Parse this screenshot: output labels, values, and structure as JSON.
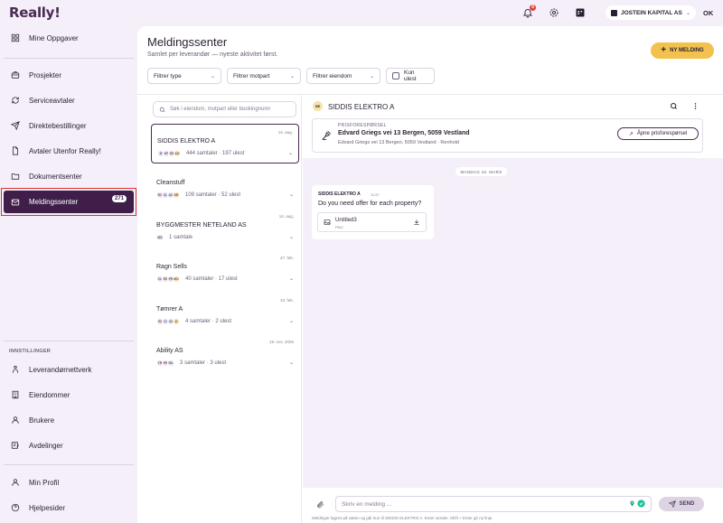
{
  "app": {
    "logo": "Really!"
  },
  "topbar": {
    "notification_count": "9",
    "org_name": "JOSTEIN KAPITAL AS",
    "user_initials": "OK"
  },
  "sidebar": {
    "items": [
      {
        "label": "Mine Oppgaver",
        "icon": "grid-icon"
      },
      {
        "label": "Prosjekter",
        "icon": "briefcase-icon"
      },
      {
        "label": "Serviceavtaler",
        "icon": "refresh-icon"
      },
      {
        "label": "Direktebestillinger",
        "icon": "send-icon"
      },
      {
        "label": "Avtaler Utenfor Really!",
        "icon": "document-icon"
      },
      {
        "label": "Dokumentsenter",
        "icon": "folder-icon"
      },
      {
        "label": "Meldingssenter",
        "icon": "mail-icon",
        "badge": "271",
        "active": true
      }
    ],
    "settings_label": "INNSTILLINGER",
    "settings_items": [
      {
        "label": "Leverandørnettverk",
        "icon": "network-icon"
      },
      {
        "label": "Eiendommer",
        "icon": "building-icon"
      },
      {
        "label": "Brukere",
        "icon": "user-icon"
      },
      {
        "label": "Avdelinger",
        "icon": "department-icon"
      }
    ],
    "footer_items": [
      {
        "label": "Min Profil",
        "icon": "profile-icon"
      },
      {
        "label": "Hjelpesider",
        "icon": "help-icon"
      }
    ]
  },
  "main": {
    "title": "Meldingssenter",
    "subtitle": "Samlet per leverandør — nyeste aktivitet først.",
    "new_button": "NY MELDING",
    "filters": {
      "type": "Filtrer type",
      "counterparty": "Filtrer motpart",
      "property": "Filtrer eiendom",
      "unread": "Kun ulest"
    },
    "search_placeholder": "Søk i eiendom, motpart eller bookingnumr"
  },
  "conversations": [
    {
      "name": "SIDDIS ELEKTRO A",
      "date": "14. aug.",
      "meta": "444 samtaler · 197 ulest",
      "avatars": [
        "H",
        "KF",
        "SE",
        "AG"
      ]
    },
    {
      "name": "Cleanstuff",
      "date": "",
      "meta": "109 samtaler · 52 ulest",
      "avatars": [
        "RC",
        "CL",
        "AC",
        "DR"
      ]
    },
    {
      "name": "BYGGMESTER NETELAND AS",
      "date": "14. aug.",
      "meta": "1 samtale",
      "avatars": [
        "MG"
      ]
    },
    {
      "name": "Ragn Sells",
      "date": "27. feb.",
      "meta": "40 samtaler · 17 ulest",
      "avatars": [
        "CL",
        "RS",
        "PR",
        "MO"
      ]
    },
    {
      "name": "Tømrer A",
      "date": "10. feb.",
      "meta": "4 samtaler · 2 ulest",
      "avatars": [
        "BI",
        "CI",
        "33",
        "4I"
      ]
    },
    {
      "name": "Ability AS",
      "date": "19. nov. 2025",
      "meta": "3 samtaler · 3 ulest",
      "avatars": [
        "TR",
        "PE",
        "RA"
      ]
    }
  ],
  "chat": {
    "avatar": "SE",
    "title": "SIDDIS ELEKTRO A",
    "price_request": {
      "label": "PRISFORESPØRSEL",
      "title": "Edvard Griegs vei 13 Bergen, 5059 Vestland",
      "subtitle": "Edvard Griegs vei 13 Bergen, 5059 Vestland · Renhold",
      "button": "Åpne prisforespørsel"
    },
    "date_divider": "MANDAG 16. MARS",
    "message": {
      "sender": "SIDDIS ELEKTRO A",
      "time": "11:57",
      "text": "Do you need offer for each property?",
      "attachment_name": "Untitled3",
      "attachment_type": "PNG"
    },
    "composer_placeholder": "Skriv en melding ...",
    "send_label": "SEND",
    "hint": "Meldinger lagres på saken og går kun til SIDDIS ELEKTRO A. Enter sender, Shift + Enter gir ny linje."
  }
}
